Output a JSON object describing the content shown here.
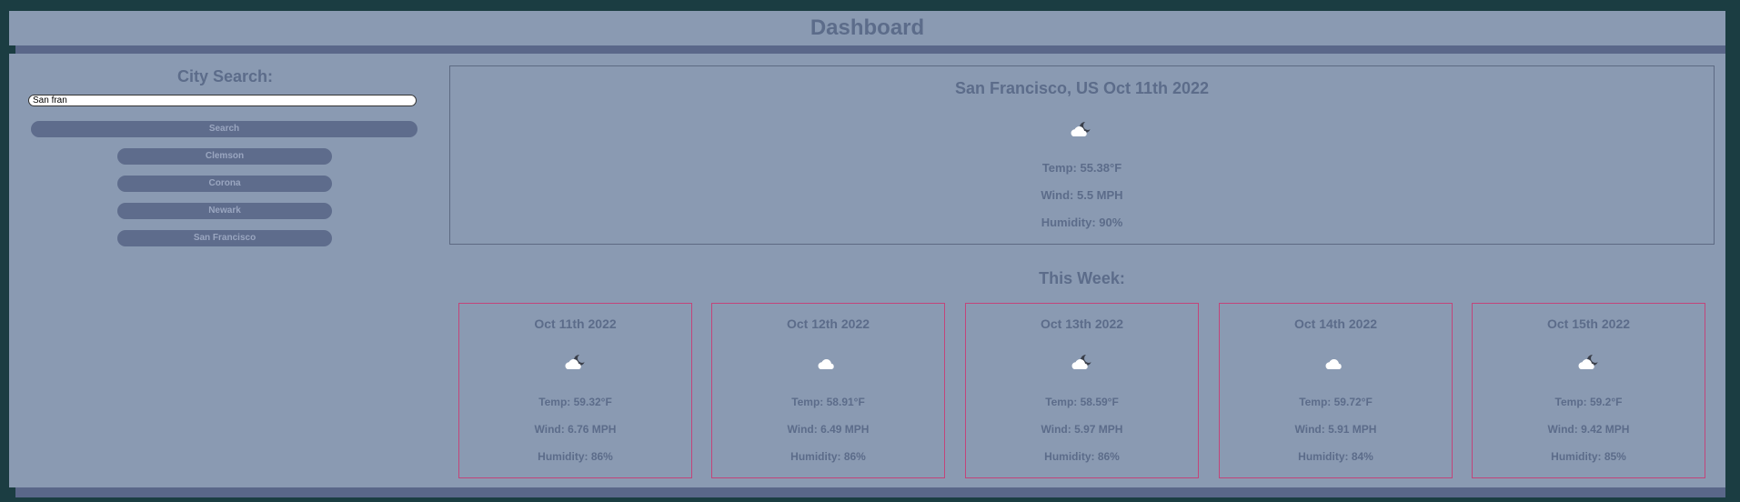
{
  "header": {
    "title": "Dashboard"
  },
  "sidebar": {
    "heading": "City Search:",
    "search_value": "San fran",
    "search_button": "Search",
    "history": [
      "Clemson",
      "Corona",
      "Newark",
      "San Francisco"
    ]
  },
  "current": {
    "title": "San Francisco, US Oct 11th 2022",
    "icon": "partly-cloudy-night-icon",
    "temp": "Temp: 55.38°F",
    "wind": "Wind: 5.5 MPH",
    "humidity": "Humidity: 90%"
  },
  "forecast": {
    "heading": "This Week:",
    "days": [
      {
        "date": "Oct 11th 2022",
        "icon": "partly-cloudy-night-icon",
        "temp": "Temp: 59.32°F",
        "wind": "Wind: 6.76 MPH",
        "humidity": "Humidity: 86%"
      },
      {
        "date": "Oct 12th 2022",
        "icon": "cloud-icon",
        "temp": "Temp: 58.91°F",
        "wind": "Wind: 6.49 MPH",
        "humidity": "Humidity: 86%"
      },
      {
        "date": "Oct 13th 2022",
        "icon": "partly-cloudy-night-icon",
        "temp": "Temp: 58.59°F",
        "wind": "Wind: 5.97 MPH",
        "humidity": "Humidity: 86%"
      },
      {
        "date": "Oct 14th 2022",
        "icon": "cloud-icon",
        "temp": "Temp: 59.72°F",
        "wind": "Wind: 5.91 MPH",
        "humidity": "Humidity: 84%"
      },
      {
        "date": "Oct 15th 2022",
        "icon": "partly-cloudy-night-icon",
        "temp": "Temp: 59.2°F",
        "wind": "Wind: 9.42 MPH",
        "humidity": "Humidity: 85%"
      }
    ]
  },
  "colors": {
    "background": "#1b3d42",
    "panel": "#8a9ab2",
    "text": "#5c6c8a",
    "button": "#5e6c8c",
    "card_border": "#c2457a"
  }
}
